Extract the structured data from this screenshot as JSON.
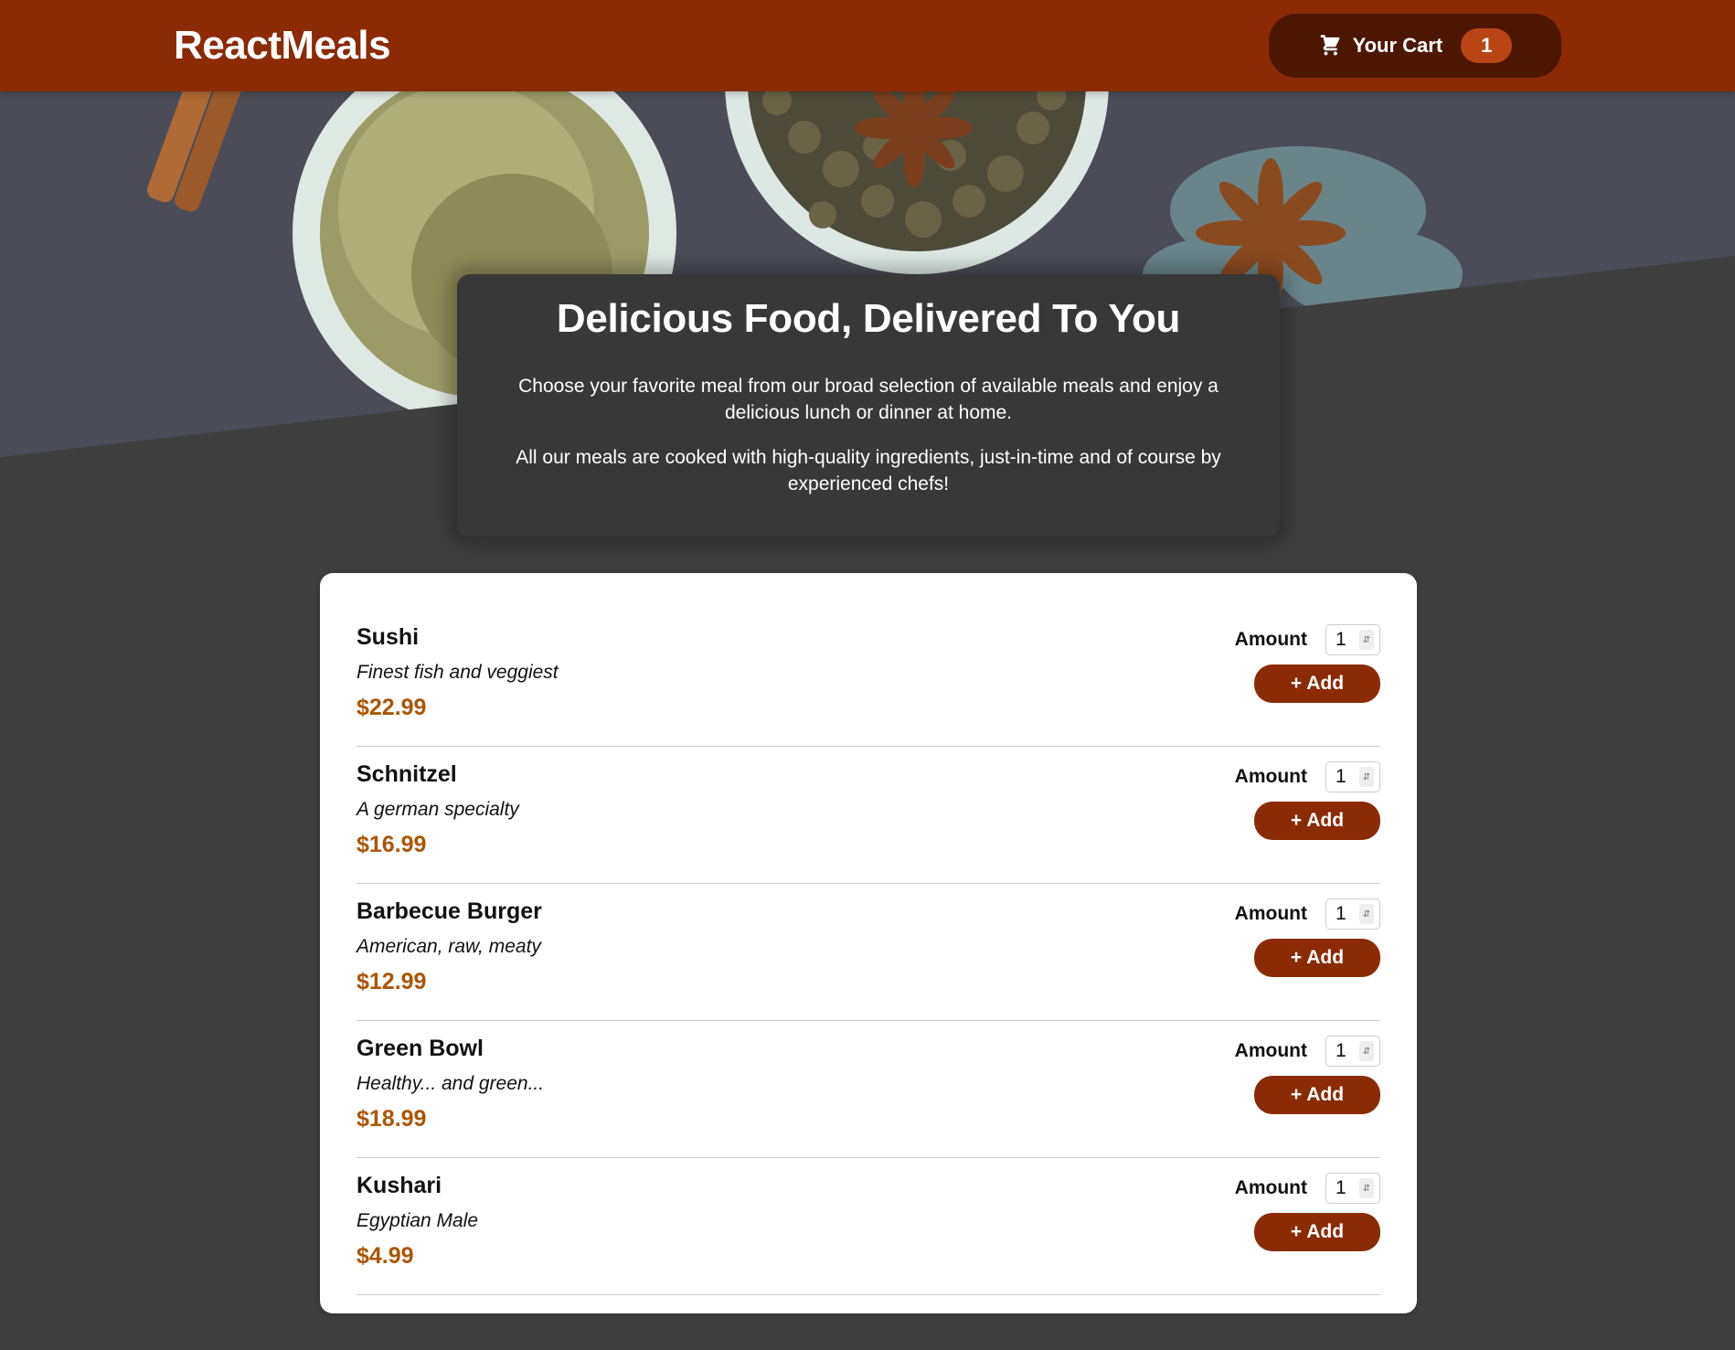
{
  "header": {
    "logo": "ReactMeals",
    "cart_label": "Your Cart",
    "cart_count": "1"
  },
  "summary": {
    "title": "Delicious Food, Delivered To You",
    "paragraph_1": "Choose your favorite meal from our broad selection of available meals and enjoy a delicious lunch or dinner at home.",
    "paragraph_2": "All our meals are cooked with high-quality ingredients, just-in-time and of course by experienced chefs!"
  },
  "meals": [
    {
      "name": "Sushi",
      "description": "Finest fish and veggiest",
      "price": "$22.99",
      "amount_label": "Amount",
      "amount_value": "1",
      "add_label": "+ Add"
    },
    {
      "name": "Schnitzel",
      "description": "A german specialty",
      "price": "$16.99",
      "amount_label": "Amount",
      "amount_value": "1",
      "add_label": "+ Add"
    },
    {
      "name": "Barbecue Burger",
      "description": "American, raw, meaty",
      "price": "$12.99",
      "amount_label": "Amount",
      "amount_value": "1",
      "add_label": "+ Add"
    },
    {
      "name": "Green Bowl",
      "description": "Healthy... and green...",
      "price": "$18.99",
      "amount_label": "Amount",
      "amount_value": "1",
      "add_label": "+ Add"
    },
    {
      "name": "Kushari",
      "description": "Egyptian Male",
      "price": "$4.99",
      "amount_label": "Amount",
      "amount_value": "1",
      "add_label": "+ Add"
    }
  ],
  "colors": {
    "header_bg": "#8a2b06",
    "cart_button_bg": "#4d1601",
    "badge_bg": "#b94517",
    "page_bg": "#3f3f3f",
    "price": "#ad5502"
  }
}
